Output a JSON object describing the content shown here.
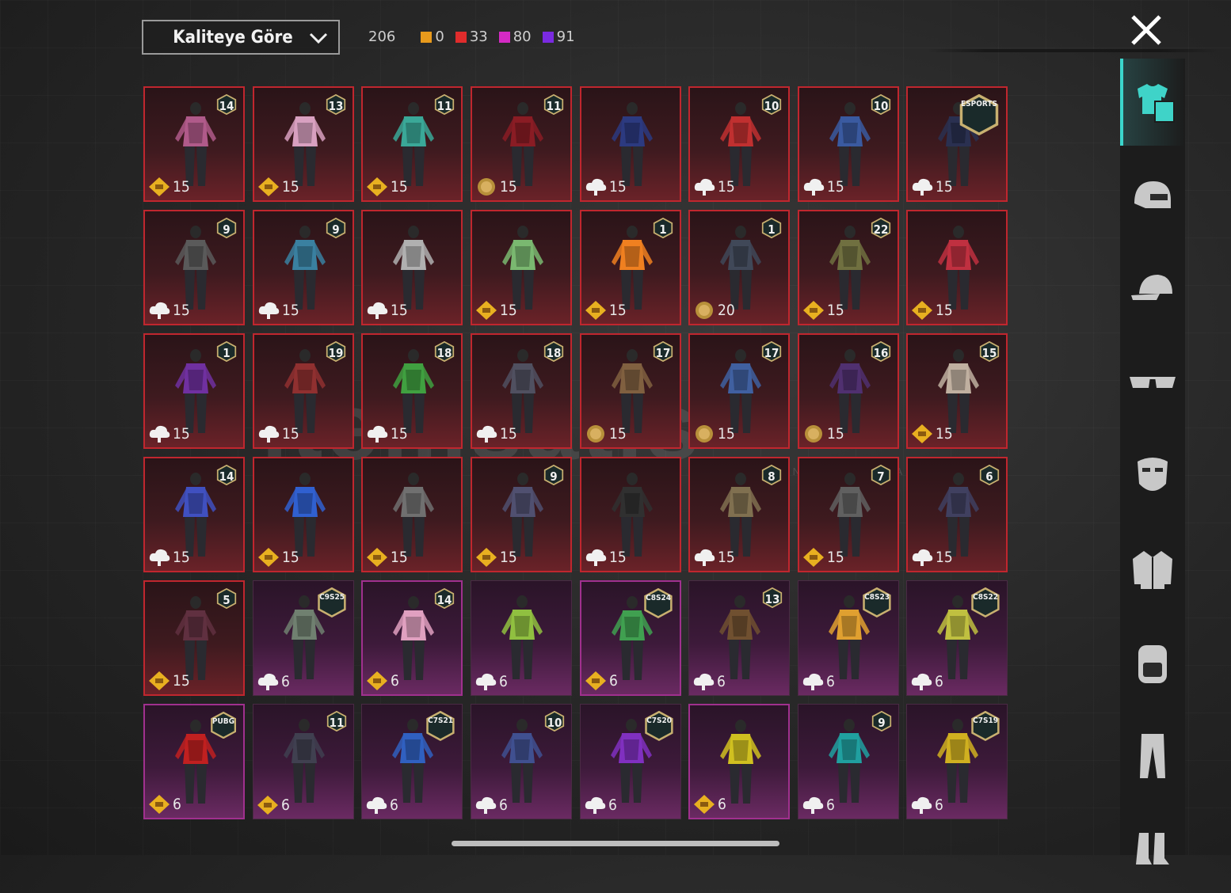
{
  "sort": {
    "label": "Kaliteye Göre"
  },
  "counts": {
    "total": "206",
    "items": [
      {
        "color": "#e89a1c",
        "value": "0"
      },
      {
        "color": "#e02c2c",
        "value": "33"
      },
      {
        "color": "#d42ac4",
        "value": "80"
      },
      {
        "color": "#7a2ae0",
        "value": "91"
      }
    ]
  },
  "watermark": {
    "text": "itemsatis",
    "sub": "HESAP / SKIN / ITEM / PARA  .com"
  },
  "sidebar": [
    "outfit-icon",
    "helmet-icon",
    "cap-icon",
    "glasses-icon",
    "mask-icon",
    "jacket-icon",
    "backpack-icon",
    "pants-icon",
    "boots-icon"
  ],
  "cards": [
    {
      "rarity": "red",
      "badge": "14",
      "foot": "gold",
      "num": "15",
      "color": "#b05a8a"
    },
    {
      "rarity": "red",
      "badge": "13",
      "foot": "gold",
      "num": "15",
      "color": "#d8a0c0"
    },
    {
      "rarity": "red",
      "badge": "11",
      "foot": "gold",
      "num": "15",
      "color": "#3aa898"
    },
    {
      "rarity": "red",
      "badge": "11",
      "foot": "coin",
      "num": "15",
      "color": "#8a1c24"
    },
    {
      "rarity": "red",
      "badge": "",
      "foot": "cloud",
      "num": "15",
      "color": "#2c3a80"
    },
    {
      "rarity": "red",
      "badge": "10",
      "foot": "cloud",
      "num": "15",
      "color": "#c03030"
    },
    {
      "rarity": "red",
      "badge": "10",
      "foot": "cloud",
      "num": "15",
      "color": "#3a5aa0"
    },
    {
      "rarity": "red",
      "badge": "ESPORTS",
      "foot": "cloud",
      "num": "15",
      "color": "#2a3050"
    },
    {
      "rarity": "red",
      "badge": "9",
      "foot": "cloud",
      "num": "15",
      "color": "#5a5a5a"
    },
    {
      "rarity": "red",
      "badge": "9",
      "foot": "cloud",
      "num": "15",
      "color": "#3a80a0"
    },
    {
      "rarity": "red",
      "badge": "",
      "foot": "cloud",
      "num": "15",
      "color": "#b0b0b0"
    },
    {
      "rarity": "red",
      "badge": "",
      "foot": "gold",
      "num": "15",
      "color": "#7ab870"
    },
    {
      "rarity": "red",
      "badge": "1",
      "foot": "gold",
      "num": "15",
      "color": "#f08020"
    },
    {
      "rarity": "red",
      "badge": "1",
      "foot": "coin",
      "num": "20",
      "color": "#404858"
    },
    {
      "rarity": "red",
      "badge": "22",
      "foot": "gold",
      "num": "15",
      "color": "#707040"
    },
    {
      "rarity": "red",
      "badge": "",
      "foot": "gold",
      "num": "15",
      "color": "#c03040"
    },
    {
      "rarity": "red",
      "badge": "1",
      "foot": "cloud",
      "num": "15",
      "color": "#7030a0"
    },
    {
      "rarity": "red",
      "badge": "19",
      "foot": "cloud",
      "num": "15",
      "color": "#903030"
    },
    {
      "rarity": "red",
      "badge": "18",
      "foot": "cloud",
      "num": "15",
      "color": "#40a040"
    },
    {
      "rarity": "red",
      "badge": "18",
      "foot": "cloud",
      "num": "15",
      "color": "#505060"
    },
    {
      "rarity": "red",
      "badge": "17",
      "foot": "coin",
      "num": "15",
      "color": "#806040"
    },
    {
      "rarity": "red",
      "badge": "17",
      "foot": "coin",
      "num": "15",
      "color": "#4060a0"
    },
    {
      "rarity": "red",
      "badge": "16",
      "foot": "coin",
      "num": "15",
      "color": "#503070"
    },
    {
      "rarity": "red",
      "badge": "15",
      "foot": "gold",
      "num": "15",
      "color": "#c0b0a0"
    },
    {
      "rarity": "red",
      "badge": "14",
      "foot": "cloud",
      "num": "15",
      "color": "#4050c0"
    },
    {
      "rarity": "red",
      "badge": "",
      "foot": "gold",
      "num": "15",
      "color": "#3060d0"
    },
    {
      "rarity": "red",
      "badge": "",
      "foot": "gold",
      "num": "15",
      "color": "#707070"
    },
    {
      "rarity": "red",
      "badge": "9",
      "foot": "gold",
      "num": "15",
      "color": "#505070"
    },
    {
      "rarity": "red",
      "badge": "",
      "foot": "cloud",
      "num": "15",
      "color": "#303030"
    },
    {
      "rarity": "red",
      "badge": "8",
      "foot": "cloud",
      "num": "15",
      "color": "#807050"
    },
    {
      "rarity": "red",
      "badge": "7",
      "foot": "gold",
      "num": "15",
      "color": "#606060"
    },
    {
      "rarity": "red",
      "badge": "6",
      "foot": "cloud",
      "num": "15",
      "color": "#404060"
    },
    {
      "rarity": "red",
      "badge": "5",
      "foot": "gold",
      "num": "15",
      "color": "#603040"
    },
    {
      "rarity": "dark",
      "badge": "C9S25",
      "foot": "cloud",
      "num": "6",
      "color": "#708070"
    },
    {
      "rarity": "purple",
      "badge": "14",
      "foot": "gold",
      "num": "6",
      "color": "#e0a0c0"
    },
    {
      "rarity": "dark",
      "badge": "",
      "foot": "cloud",
      "num": "6",
      "color": "#90c040"
    },
    {
      "rarity": "purple",
      "badge": "C8S24",
      "foot": "gold",
      "num": "6",
      "color": "#40a050"
    },
    {
      "rarity": "dark",
      "badge": "13",
      "foot": "cloud",
      "num": "6",
      "color": "#705030"
    },
    {
      "rarity": "dark",
      "badge": "C8S23",
      "foot": "cloud",
      "num": "6",
      "color": "#e0a030"
    },
    {
      "rarity": "dark",
      "badge": "C8S22",
      "foot": "cloud",
      "num": "6",
      "color": "#c0c040"
    },
    {
      "rarity": "purple",
      "badge": "PUBG",
      "foot": "gold",
      "num": "6",
      "color": "#c02020"
    },
    {
      "rarity": "dark",
      "badge": "11",
      "foot": "gold",
      "num": "6",
      "color": "#404050"
    },
    {
      "rarity": "dark",
      "badge": "C7S21",
      "foot": "cloud",
      "num": "6",
      "color": "#3060c0"
    },
    {
      "rarity": "dark",
      "badge": "10",
      "foot": "cloud",
      "num": "6",
      "color": "#405090"
    },
    {
      "rarity": "dark",
      "badge": "C7S20",
      "foot": "cloud",
      "num": "6",
      "color": "#8030c0"
    },
    {
      "rarity": "purple",
      "badge": "",
      "foot": "gold",
      "num": "6",
      "color": "#d0c020"
    },
    {
      "rarity": "dark",
      "badge": "9",
      "foot": "cloud",
      "num": "6",
      "color": "#20a0a0"
    },
    {
      "rarity": "dark",
      "badge": "C7S19",
      "foot": "cloud",
      "num": "6",
      "color": "#d0b020"
    }
  ]
}
